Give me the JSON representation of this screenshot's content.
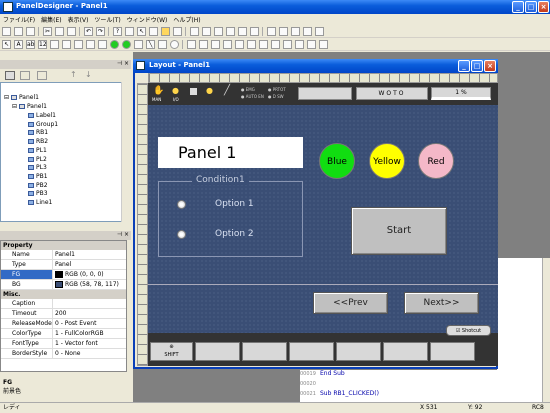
{
  "app": {
    "title": "PanelDesigner - Panel1"
  },
  "menu": [
    "ファイル(F)",
    "編集(E)",
    "表示(V)",
    "ツール(T)",
    "ウィンドウ(W)",
    "ヘルプ(H)"
  ],
  "project_tree": {
    "root": "Panel1",
    "panel": "Panel1",
    "items": [
      "Label1",
      "Group1",
      "RB1",
      "RB2",
      "PL1",
      "PL2",
      "PL3",
      "PB1",
      "PB2",
      "PB3",
      "Line1"
    ]
  },
  "properties": {
    "section1": "Property",
    "section2": "Misc.",
    "rows1": [
      [
        "Name",
        "Panel1"
      ],
      [
        "Type",
        "Panel"
      ],
      [
        "FG",
        "RGB (0, 0, 0)"
      ],
      [
        "BG",
        "RGB (58, 78, 117)"
      ]
    ],
    "rows2": [
      [
        "Caption",
        ""
      ],
      [
        "Timeout",
        "200"
      ],
      [
        "ReleaseMode",
        "0 - Post Event"
      ],
      [
        "ColorType",
        "1 - FullColorRGB"
      ],
      [
        "FontType",
        "1 - Vector font"
      ],
      [
        "BorderStyle",
        "0 - None"
      ]
    ],
    "fg_color": "#000000",
    "bg_color": "#3a4e75",
    "desc_title": "FG",
    "desc_text": "前景色"
  },
  "layout_window": {
    "title": "Layout - Panel1"
  },
  "hmi": {
    "top_labels": {
      "man": "MAN",
      "io": "I/O",
      "emg": "EMG",
      "prot": "PRTOT",
      "auto": "AUTO EN",
      "dsw": "D SW"
    },
    "wcs": "WOTO",
    "pct": "1 %",
    "panel_title": "Panel 1",
    "lamps": [
      {
        "label": "Blue",
        "color": "#11dd11"
      },
      {
        "label": "Yellow",
        "color": "#ffff00"
      },
      {
        "label": "Red",
        "color": "#f4b8c8"
      }
    ],
    "group_title": "Condition1",
    "options": [
      "Option 1",
      "Option 2"
    ],
    "start": "Start",
    "prev": "<<Prev",
    "next": "Next>>",
    "shotcut": "Shotcut",
    "shift": "SHIFT"
  },
  "code": [
    [
      "00019",
      "End Sub"
    ],
    [
      "00020",
      ""
    ],
    [
      "00021",
      "Sub RB1_CLICKED()"
    ]
  ],
  "status": {
    "left": "レディ",
    "x": "X    531",
    "y": "Y:    92",
    "mode": "RC8"
  }
}
